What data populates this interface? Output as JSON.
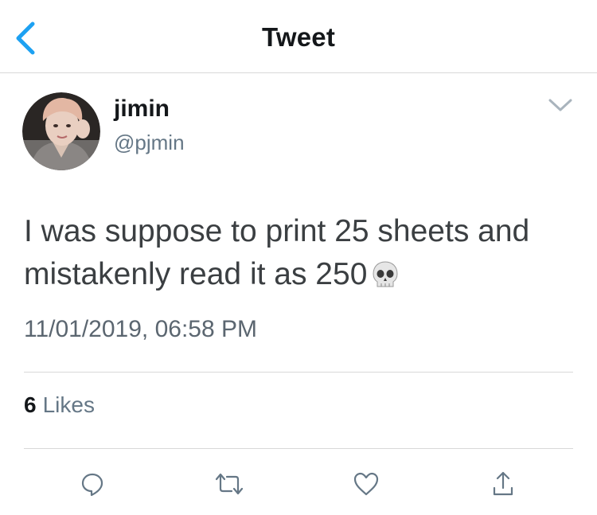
{
  "nav": {
    "title": "Tweet",
    "back_icon": "chevron-left-icon",
    "accent_color": "#1da1f2"
  },
  "author": {
    "display_name": "jimin",
    "handle": "@pjmin",
    "avatar": "avatar-photo"
  },
  "tweet": {
    "text": "I was suppose to print 25 sheets and mistakenly read it as 250",
    "emoji": "skull-icon",
    "timestamp": "11/01/2019, 06:58 PM"
  },
  "stats": {
    "likes_count": "6",
    "likes_label": "Likes"
  },
  "actions": [
    {
      "name": "reply",
      "icon": "reply-icon"
    },
    {
      "name": "retweet",
      "icon": "retweet-icon"
    },
    {
      "name": "like",
      "icon": "heart-icon"
    },
    {
      "name": "share",
      "icon": "share-icon"
    }
  ],
  "colors": {
    "text_primary": "#14171a",
    "text_secondary": "#657786",
    "divider": "#d8d8d8",
    "icon_gray": "#657786"
  }
}
